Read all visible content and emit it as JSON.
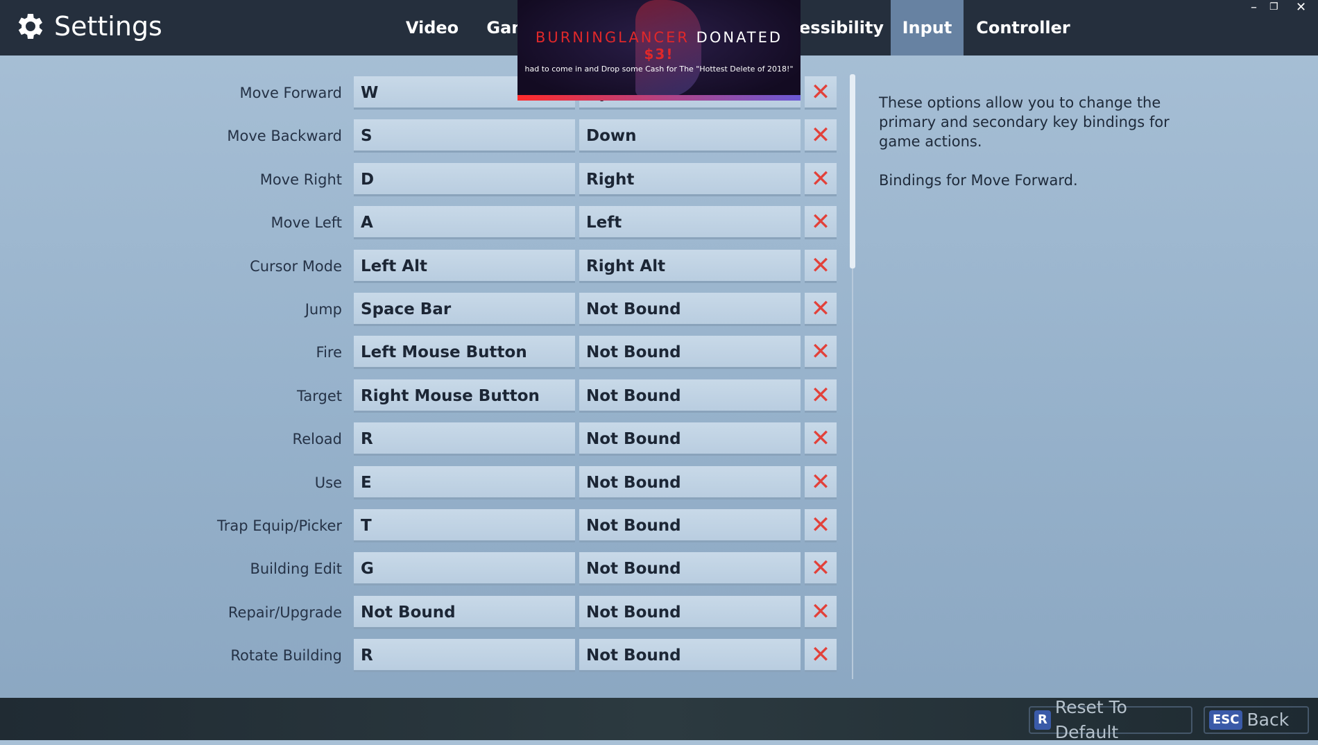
{
  "header": {
    "title": "Settings",
    "tabs": [
      {
        "label": "Video"
      },
      {
        "label": "Game"
      },
      {
        "label": "Accessibility"
      },
      {
        "label": "Input",
        "active": true
      },
      {
        "label": "Controller"
      }
    ]
  },
  "window_controls": {
    "minimize": "–",
    "restore": "❐",
    "close": "✕"
  },
  "bindings": [
    {
      "action": "Move Forward",
      "primary": "W",
      "secondary": "Up"
    },
    {
      "action": "Move Backward",
      "primary": "S",
      "secondary": "Down"
    },
    {
      "action": "Move Right",
      "primary": "D",
      "secondary": "Right"
    },
    {
      "action": "Move Left",
      "primary": "A",
      "secondary": "Left"
    },
    {
      "action": "Cursor Mode",
      "primary": "Left Alt",
      "secondary": "Right Alt"
    },
    {
      "action": "Jump",
      "primary": "Space Bar",
      "secondary": "Not Bound"
    },
    {
      "action": "Fire",
      "primary": "Left Mouse Button",
      "secondary": "Not Bound"
    },
    {
      "action": "Target",
      "primary": "Right Mouse Button",
      "secondary": "Not Bound"
    },
    {
      "action": "Reload",
      "primary": "R",
      "secondary": "Not Bound"
    },
    {
      "action": "Use",
      "primary": "E",
      "secondary": "Not Bound"
    },
    {
      "action": "Trap Equip/Picker",
      "primary": "T",
      "secondary": "Not Bound"
    },
    {
      "action": "Building Edit",
      "primary": "G",
      "secondary": "Not Bound"
    },
    {
      "action": "Repair/Upgrade",
      "primary": "Not Bound",
      "secondary": "Not Bound"
    },
    {
      "action": "Rotate Building",
      "primary": "R",
      "secondary": "Not Bound"
    }
  ],
  "clear_glyph": "✕",
  "description": {
    "text": "These options allow you to change the primary and secondary key bindings for game actions.",
    "selected": "Bindings for Move Forward."
  },
  "footer": {
    "reset": {
      "key": "R",
      "label": "Reset To Default"
    },
    "back": {
      "key": "ESC",
      "label": "Back"
    }
  },
  "donation": {
    "name": "BURNINGLANCER",
    "verb": "DONATED",
    "amount": "$3!",
    "message": "had to come in and Drop some Cash for The \"Hottest Delete of 2018!\""
  },
  "colors": {
    "clear": "#e2413a",
    "active_tab": "#6782a2",
    "topbar": "#252f3d"
  }
}
